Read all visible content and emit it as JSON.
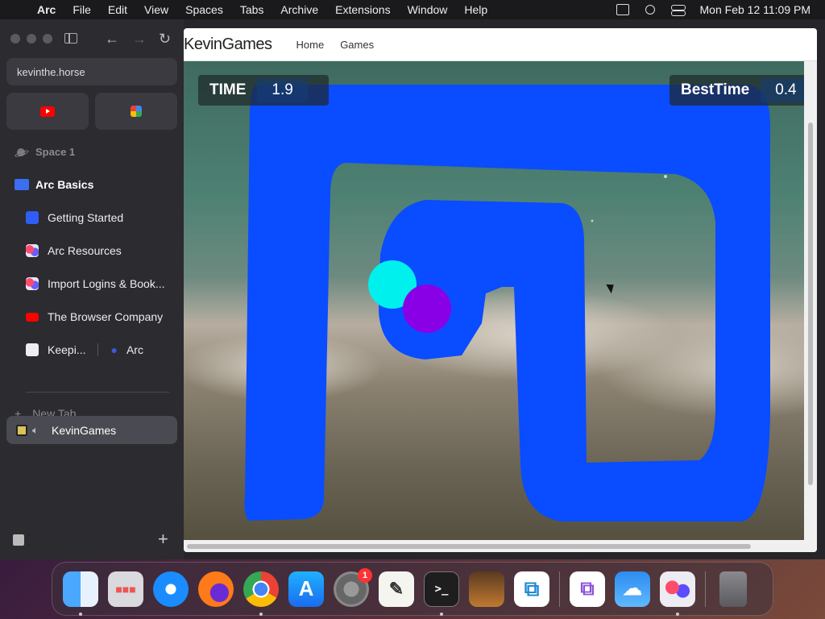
{
  "menubar": {
    "app": "Arc",
    "items": [
      "File",
      "Edit",
      "View",
      "Spaces",
      "Tabs",
      "Archive",
      "Extensions",
      "Window",
      "Help"
    ],
    "clock": "Mon Feb 12  11:09 PM"
  },
  "sidebar": {
    "url": "kevinthe.horse",
    "space_label": "Space 1",
    "folder": "Arc Basics",
    "tabs": [
      {
        "label": "Getting Started",
        "icon": "blue-square-icon"
      },
      {
        "label": "Arc Resources",
        "icon": "arc-icon"
      },
      {
        "label": "Import Logins & Book...",
        "icon": "arc-icon"
      },
      {
        "label": "The Browser Company",
        "icon": "youtube-icon"
      }
    ],
    "split_tab": {
      "left": "Keepi...",
      "right": "Arc"
    },
    "new_tab": "New Tab",
    "active_tab": "KevinGames"
  },
  "site": {
    "logo": "KevinGames",
    "links": [
      "Home",
      "Games"
    ]
  },
  "game": {
    "time_label": "TIME",
    "time_value": "1.9",
    "best_label": "BestTime",
    "best_value": "0.4",
    "colors": {
      "path": "#0a4cff",
      "start_ball": "#00f0ee",
      "player_ball": "#8a00e6"
    }
  },
  "dock": {
    "apps": [
      "finder",
      "launchpad",
      "safari",
      "firefox",
      "chrome",
      "app-store",
      "system-settings",
      "textedit",
      "terminal",
      "garageband",
      "vscode",
      "visual-studio",
      "weather",
      "arc",
      "trash"
    ],
    "settings_badge": "1"
  }
}
